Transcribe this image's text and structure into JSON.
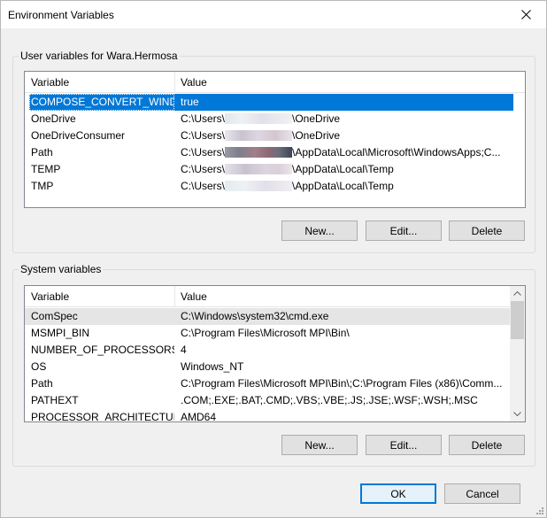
{
  "window": {
    "title": "Environment Variables"
  },
  "user_vars": {
    "group_label": "User variables for Wara.Hermosa",
    "columns": [
      "Variable",
      "Value"
    ],
    "rows": [
      {
        "name": "COMPOSE_CONVERT_WIND...",
        "pre": "true",
        "post": "",
        "selected": true
      },
      {
        "name": "OneDrive",
        "pre": "C:\\Users\\",
        "post": "\\OneDrive"
      },
      {
        "name": "OneDriveConsumer",
        "pre": "C:\\Users\\",
        "post": "\\OneDrive"
      },
      {
        "name": "Path",
        "pre": "C:\\Users\\",
        "post": "\\AppData\\Local\\Microsoft\\WindowsApps;C..."
      },
      {
        "name": "TEMP",
        "pre": "C:\\Users\\",
        "post": "\\AppData\\Local\\Temp"
      },
      {
        "name": "TMP",
        "pre": "C:\\Users\\",
        "post": "\\AppData\\Local\\Temp"
      }
    ],
    "buttons": {
      "new": "New...",
      "edit": "Edit...",
      "delete": "Delete"
    }
  },
  "system_vars": {
    "group_label": "System variables",
    "columns": [
      "Variable",
      "Value"
    ],
    "rows": [
      {
        "name": "ComSpec",
        "value": "C:\\Windows\\system32\\cmd.exe"
      },
      {
        "name": "MSMPI_BIN",
        "value": "C:\\Program Files\\Microsoft MPI\\Bin\\"
      },
      {
        "name": "NUMBER_OF_PROCESSORS",
        "value": "4"
      },
      {
        "name": "OS",
        "value": "Windows_NT"
      },
      {
        "name": "Path",
        "value": "C:\\Program Files\\Microsoft MPI\\Bin\\;C:\\Program Files (x86)\\Comm..."
      },
      {
        "name": "PATHEXT",
        "value": ".COM;.EXE;.BAT;.CMD;.VBS;.VBE;.JS;.JSE;.WSF;.WSH;.MSC"
      },
      {
        "name": "PROCESSOR_ARCHITECTURE",
        "value": "AMD64"
      }
    ],
    "buttons": {
      "new": "New...",
      "edit": "Edit...",
      "delete": "Delete"
    }
  },
  "footer": {
    "ok": "OK",
    "cancel": "Cancel"
  },
  "colors": {
    "selection": "#0078d7",
    "hover_row": "#e5e5e5",
    "default_button_border": "#0078d7"
  }
}
